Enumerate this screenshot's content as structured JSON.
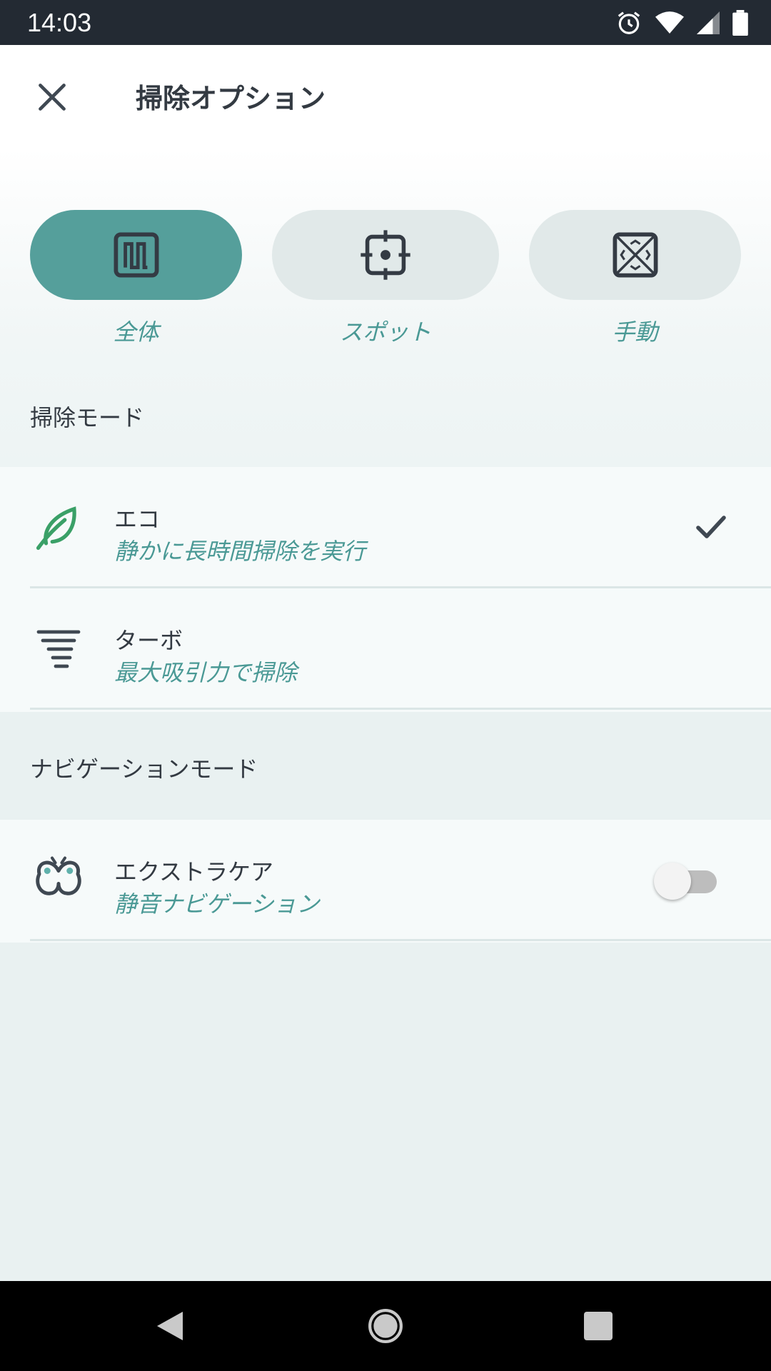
{
  "status_bar": {
    "time": "14:03",
    "icons": [
      "alarm-icon",
      "wifi-icon",
      "signal-icon",
      "battery-icon"
    ]
  },
  "header": {
    "title": "掃除オプション",
    "close_icon": "close-icon"
  },
  "clean_types": [
    {
      "label": "全体",
      "icon": "whole-area-icon",
      "selected": true
    },
    {
      "label": "スポット",
      "icon": "spot-target-icon",
      "selected": false
    },
    {
      "label": "手動",
      "icon": "manual-icon",
      "selected": false
    }
  ],
  "clean_mode": {
    "heading": "掃除モード",
    "items": [
      {
        "title": "エコ",
        "subtitle": "静かに長時間掃除を実行",
        "icon": "leaf-icon",
        "selected": true
      },
      {
        "title": "ターボ",
        "subtitle": "最大吸引力で掃除",
        "icon": "tornado-icon",
        "selected": false
      }
    ]
  },
  "navigation_mode": {
    "heading": "ナビゲーションモード",
    "items": [
      {
        "title": "エクストラケア",
        "subtitle": "静音ナビゲーション",
        "icon": "butterfly-icon",
        "enabled": false
      }
    ]
  },
  "colors": {
    "accent": "#559f9b",
    "accent_text": "#4a9995",
    "eco_green": "#3aa067",
    "status_bar": "#232a33"
  },
  "system_nav": [
    "back-icon",
    "home-icon",
    "recents-icon"
  ]
}
